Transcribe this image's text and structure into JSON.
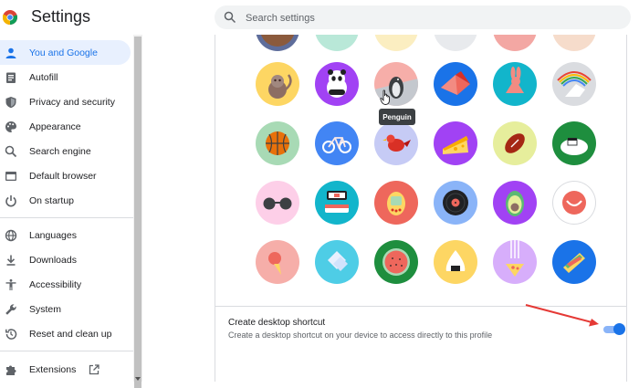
{
  "header": {
    "title": "Settings",
    "search_placeholder": "Search settings"
  },
  "sidebar": {
    "items": [
      {
        "label": "You and Google",
        "icon": "person-icon",
        "active": true
      },
      {
        "label": "Autofill",
        "icon": "clipboard-icon"
      },
      {
        "label": "Privacy and security",
        "icon": "shield-icon"
      },
      {
        "label": "Appearance",
        "icon": "palette-icon"
      },
      {
        "label": "Search engine",
        "icon": "search-icon"
      },
      {
        "label": "Default browser",
        "icon": "browser-window-icon"
      },
      {
        "label": "On startup",
        "icon": "power-icon"
      },
      {
        "label": "Languages",
        "icon": "globe-icon"
      },
      {
        "label": "Downloads",
        "icon": "download-icon"
      },
      {
        "label": "Accessibility",
        "icon": "accessibility-icon"
      },
      {
        "label": "System",
        "icon": "wrench-icon"
      },
      {
        "label": "Reset and clean up",
        "icon": "history-icon"
      },
      {
        "label": "Extensions",
        "icon": "puzzle-icon"
      }
    ]
  },
  "avatars": {
    "tooltip": "Penguin",
    "icons": [
      "monkey-avatar-icon",
      "panda-avatar-icon",
      "penguin-avatar-icon",
      "origami-bird-avatar-icon",
      "rabbit-avatar-icon",
      "unicorn-avatar-icon",
      "basketball-avatar-icon",
      "bicycle-avatar-icon",
      "red-bird-avatar-icon",
      "cheese-avatar-icon",
      "football-avatar-icon",
      "sushi-plate-avatar-icon",
      "sunglasses-avatar-icon",
      "sushi-roll-avatar-icon",
      "tamagotchi-avatar-icon",
      "vinyl-record-avatar-icon",
      "avocado-avatar-icon",
      "smiley-avatar-icon",
      "ice-cream-avatar-icon",
      "ice-cube-avatar-icon",
      "watermelon-avatar-icon",
      "onigiri-avatar-icon",
      "pizza-avatar-icon",
      "sandwich-avatar-icon"
    ]
  },
  "shortcut": {
    "title": "Create desktop shortcut",
    "description": "Create a desktop shortcut on your device to access directly to this profile",
    "enabled": true
  },
  "colors": {
    "accent": "#1a73e8",
    "annotation_arrow": "#e53935"
  }
}
